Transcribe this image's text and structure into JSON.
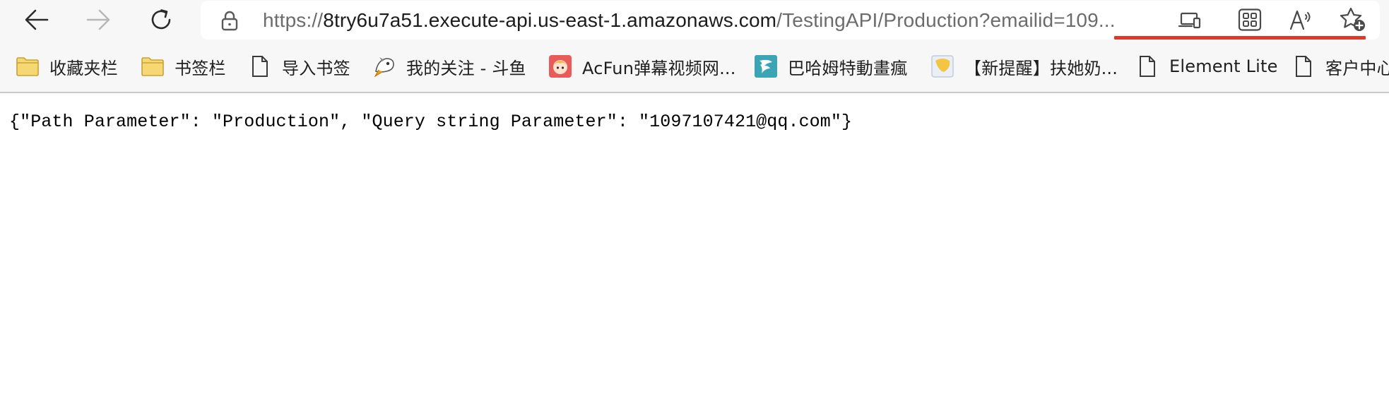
{
  "browser": {
    "nav": {
      "back_icon": "back-arrow-icon",
      "forward_icon": "forward-arrow-icon",
      "reload_icon": "reload-icon"
    },
    "address_bar": {
      "lock_icon": "lock-icon",
      "url_scheme": "https://",
      "url_host": "8try6u7a51.execute-api.us-east-1.amazonaws.com",
      "url_path": "/TestingAPI/Production?emailid=109...",
      "highlight_color": "#e2382b"
    },
    "toolbar_icons": [
      "device-icon",
      "apps-grid-icon",
      "read-aloud-icon",
      "add-favorite-icon"
    ],
    "bookmarks": [
      {
        "label": "收藏夹栏",
        "icon": "folder-icon"
      },
      {
        "label": "书签栏",
        "icon": "folder-icon"
      },
      {
        "label": "导入书签",
        "icon": "page-icon"
      },
      {
        "label": "我的关注 - 斗鱼",
        "icon": "douyu-icon"
      },
      {
        "label": "AcFun弹幕视频网...",
        "icon": "acfun-icon"
      },
      {
        "label": "巴哈姆特動畫瘋",
        "icon": "bahamut-icon"
      },
      {
        "label": "【新提醒】扶她奶...",
        "icon": "site-icon"
      },
      {
        "label": "Element Lite",
        "icon": "page-icon"
      },
      {
        "label": "客户中心",
        "icon": "page-icon"
      }
    ]
  },
  "page": {
    "body_text": "{\"Path Parameter\": \"Production\", \"Query string Parameter\": \"1097107421@qq.com\"}"
  }
}
